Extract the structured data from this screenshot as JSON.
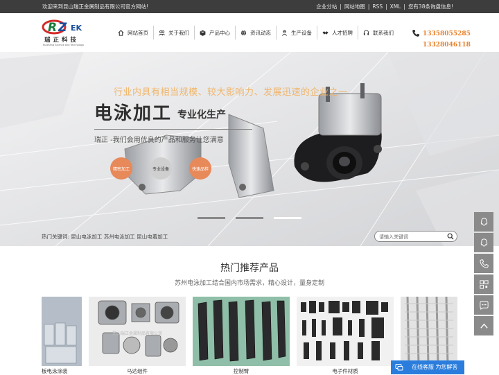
{
  "topbar": {
    "welcome": "欢迎来到昆山瑞正金属制品有限公司官方网站!",
    "links": [
      "企业分站",
      "网站地图",
      "RSS",
      "XML"
    ],
    "sep": "|",
    "inquiry": "您有38条询盘信息!"
  },
  "logo": {
    "mark": "RZ",
    "cn": "瑞正科技",
    "en": "Ruizheng Science and Technology"
  },
  "nav": [
    {
      "label": "网站首页",
      "icon": "home-icon"
    },
    {
      "label": "关于我们",
      "icon": "people-icon"
    },
    {
      "label": "产品中心",
      "icon": "box-icon"
    },
    {
      "label": "资讯动态",
      "icon": "globe-icon"
    },
    {
      "label": "生产设备",
      "icon": "worker-icon"
    },
    {
      "label": "人才招聘",
      "icon": "handshake-icon"
    },
    {
      "label": "联系我们",
      "icon": "headset-icon"
    }
  ],
  "phone": {
    "p1": "13358055285",
    "p2": "13328046118",
    "icon": "phone-icon"
  },
  "banner": {
    "slogan": "行业内具有相当规模、较大影响力、发展迅速的企业之一",
    "title_big": "电泳加工",
    "title_small": "专业化生产",
    "subtitle": "瑞正 -我们会用优良的产品和服务让您满意",
    "circles": [
      "精密加工",
      "专业设备",
      "快速品样"
    ],
    "slides": 3,
    "active_slide": 3
  },
  "keywords": {
    "label": "热门关键词:",
    "items": [
      "昆山电泳加工",
      "苏州电泳加工",
      "昆山电着加工"
    ]
  },
  "search": {
    "placeholder": "请输入关键词"
  },
  "sidebar": [
    "qq-icon",
    "qq-icon",
    "phone-icon",
    "qrcode-icon",
    "chat-bubble-icon",
    "arrow-up-icon"
  ],
  "section": {
    "title": "热门推荐产品",
    "subtitle": "苏州电泳加工结合国内市场需求，精心设计，量身定制"
  },
  "products": [
    {
      "caption": "板电泳涂装"
    },
    {
      "caption": "马达组件"
    },
    {
      "caption": "控制臂"
    },
    {
      "caption": "电子件材质"
    },
    {
      "caption": ""
    }
  ],
  "watermark": "昆山瑞正金属制品有限公司",
  "chat": {
    "label": "在线客服 为您解答"
  },
  "colors": {
    "accent": "#e8812c",
    "topbar": "#3d3d3d",
    "chat": "#2a7ddc",
    "sidebar": "#8a8a8a"
  }
}
